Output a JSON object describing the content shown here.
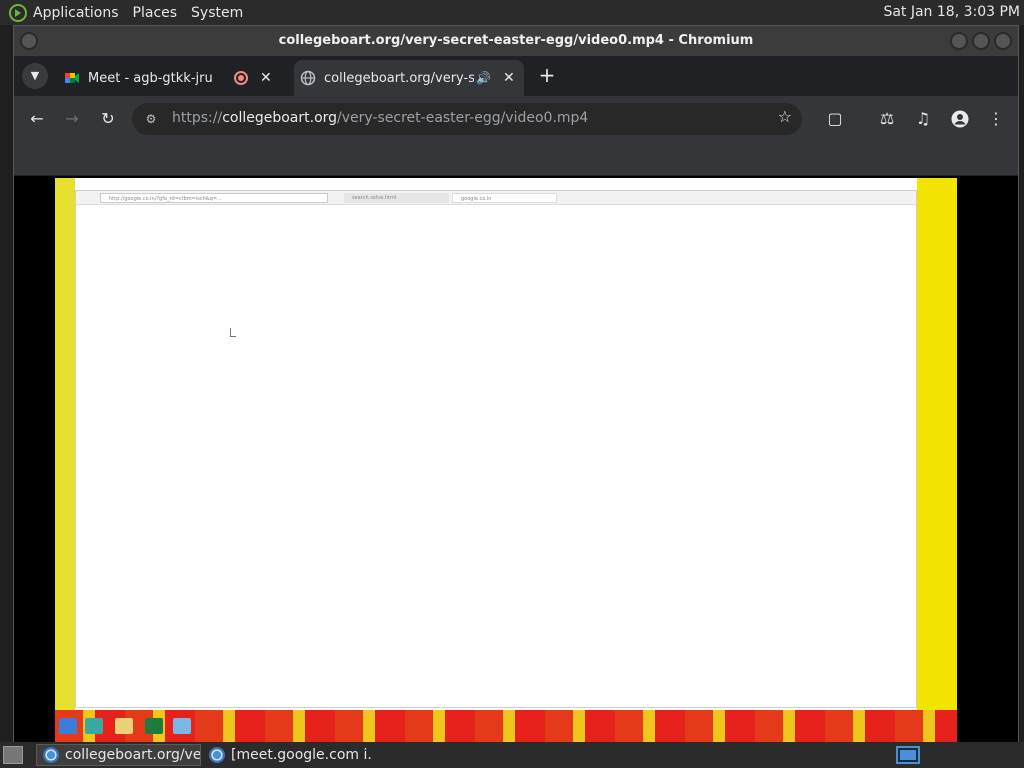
{
  "top_panel": {
    "menus": [
      "Applications",
      "Places",
      "System"
    ],
    "clock": "Sat Jan 18,  3:03 PM"
  },
  "window": {
    "title": "collegeboart.org/very-secret-easter-egg/video0.mp4 - Chromium"
  },
  "tabs": [
    {
      "label": "Meet - agb-gtkk-jru",
      "recording": true,
      "favicon": "google-meet-icon"
    },
    {
      "label": "collegeboart.org/very-sec",
      "audio": true,
      "active": true,
      "favicon": "globe-icon"
    }
  ],
  "toolbar": {
    "url_scheme": "https://",
    "url_host": "collegeboart.org",
    "url_path": "/very-secret-easter-egg/video0.mp4"
  },
  "video": {
    "inner_address": "http://google.co.in/?gfe_rd=ctbm=isch&q=...",
    "inner_tab_1": "search solve.html",
    "inner_tab_2": "google.co.in"
  },
  "bottom_panel": {
    "tasks": [
      "collegeboart.org/ve...",
      "[meet.google.com i..."
    ]
  },
  "colors": {
    "panel": "#2b2b2b",
    "tab_active": "#35363a",
    "accent_blue": "#4a90d9",
    "video_yellow": "#f3e400",
    "video_red": "#e53a1a"
  }
}
